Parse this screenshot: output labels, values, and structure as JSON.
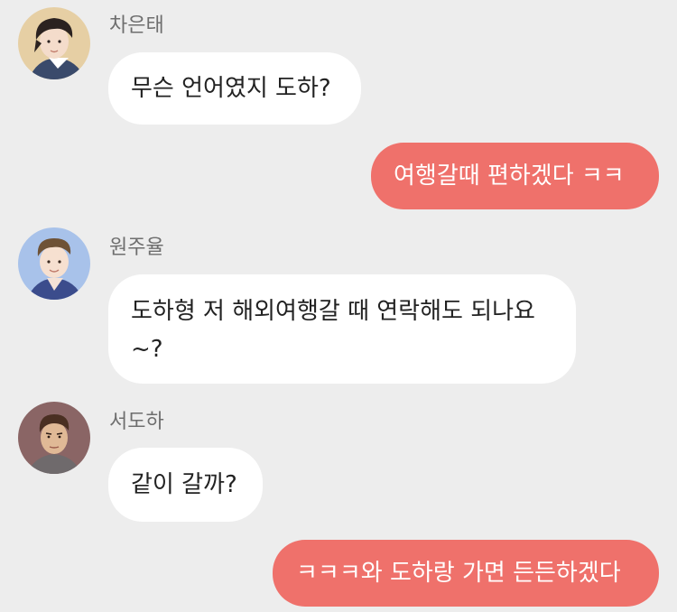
{
  "colors": {
    "background": "#ededed",
    "incoming_bubble": "#ffffff",
    "outgoing_bubble": "#ef716b",
    "sender_name": "#6e6e6e"
  },
  "messages": [
    {
      "direction": "incoming",
      "sender": "차은태",
      "avatar": "avatar-icon",
      "text": "무슨 언어였지 도하?"
    },
    {
      "direction": "outgoing",
      "text": "여행갈때 편하겠다 ㅋㅋ"
    },
    {
      "direction": "incoming",
      "sender": "원주율",
      "avatar": "avatar-icon",
      "text": "도하형 저 해외여행갈 때 연락해도 되나요~?"
    },
    {
      "direction": "incoming",
      "sender": "서도하",
      "avatar": "avatar-icon",
      "text": "같이 갈까?"
    },
    {
      "direction": "outgoing",
      "text": "ㅋㅋㅋ와 도하랑 가면 든든하겠다"
    }
  ]
}
